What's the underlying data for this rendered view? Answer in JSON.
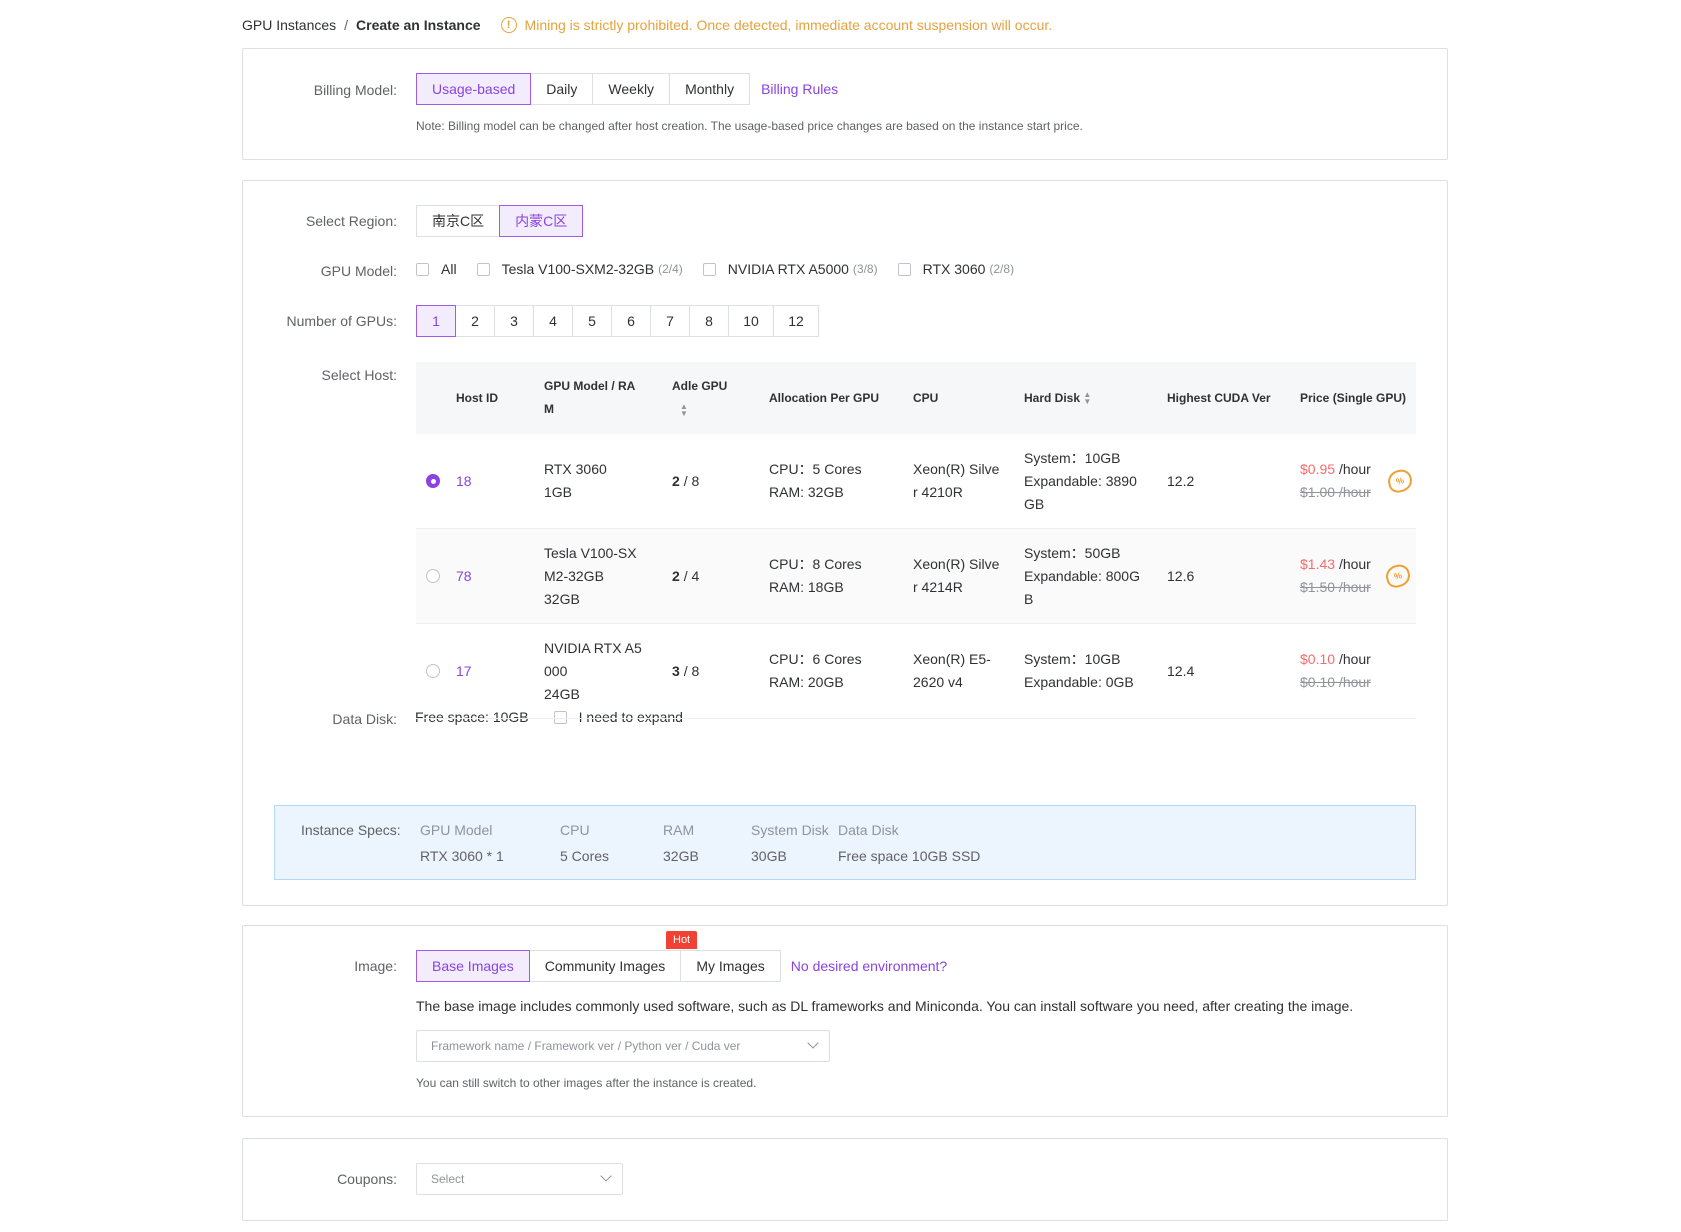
{
  "breadcrumb": {
    "parent": "GPU Instances",
    "separator": "/",
    "current": "Create an Instance"
  },
  "warning": {
    "icon": "exclamation-circle-icon",
    "text": "Mining is strictly prohibited. Once detected, immediate account suspension will occur."
  },
  "billing": {
    "label": "Billing Model:",
    "options": [
      "Usage-based",
      "Daily",
      "Weekly",
      "Monthly"
    ],
    "selected": "Usage-based",
    "rules_link": "Billing Rules",
    "note": "Note: Billing model can be changed after host creation. The usage-based price changes are based on the instance start price."
  },
  "region": {
    "label": "Select Region:",
    "options": [
      "南京C区",
      "内蒙C区"
    ],
    "selected": "内蒙C区"
  },
  "gpu_model": {
    "label": "GPU Model:",
    "options": [
      {
        "name": "All",
        "count": ""
      },
      {
        "name": "Tesla V100-SXM2-32GB",
        "count": "(2/4)"
      },
      {
        "name": "NVIDIA RTX A5000",
        "count": "(3/8)"
      },
      {
        "name": "RTX 3060",
        "count": "(2/8)"
      }
    ]
  },
  "num_gpus": {
    "label": "Number of GPUs:",
    "options": [
      "1",
      "2",
      "3",
      "4",
      "5",
      "6",
      "7",
      "8",
      "10",
      "12"
    ],
    "selected": "1"
  },
  "host": {
    "label": "Select Host:",
    "columns": [
      "Host ID",
      "GPU Model / RA",
      "M",
      "Adle GPU",
      "Allocation Per GPU",
      "CPU",
      "Hard Disk",
      "Highest CUDA Ver",
      "Price (Single GPU)"
    ],
    "rows": [
      {
        "selected": true,
        "id": "18",
        "gpu": [
          "RTX 3060",
          "1GB"
        ],
        "idle": "2",
        "total": "/ 8",
        "alloc": [
          "CPU：5 Cores",
          "RAM: 32GB"
        ],
        "cpu": [
          "Xeon(R) Silve",
          "r 4210R"
        ],
        "disk": [
          "System：10GB",
          "Expandable: 3890",
          "GB"
        ],
        "cuda": "12.2",
        "price": "$0.95",
        "unit": "/hour",
        "old_price": "$1.00 /hour",
        "has_badge": true
      },
      {
        "selected": false,
        "id": "78",
        "gpu": [
          "Tesla V100-SX",
          "M2-32GB",
          "32GB"
        ],
        "idle": "2",
        "total": "/ 4",
        "alloc": [
          "CPU：8 Cores",
          "RAM: 18GB"
        ],
        "cpu": [
          "Xeon(R) Silve",
          "r 4214R"
        ],
        "disk": [
          "System：50GB",
          "Expandable: 800G",
          "B"
        ],
        "cuda": "12.6",
        "price": "$1.43",
        "unit": "/hour",
        "old_price": "$1.50 /hour",
        "has_badge": true
      },
      {
        "selected": false,
        "id": "17",
        "gpu": [
          "NVIDIA RTX A5",
          "000",
          "24GB"
        ],
        "idle": "3",
        "total": "/ 8",
        "alloc": [
          "CPU：6 Cores",
          "RAM: 20GB"
        ],
        "cpu": [
          "Xeon(R) E5-",
          "2620 v4"
        ],
        "disk": [
          "System：10GB",
          "Expandable: 0GB"
        ],
        "cuda": "12.4",
        "price": "$0.10",
        "unit": "/hour",
        "old_price": "$0.10 /hour",
        "has_badge": false
      }
    ]
  },
  "data_disk": {
    "label": "Data Disk:",
    "free": "Free space: 10GB",
    "expand": "I need to expand"
  },
  "specs": {
    "label": "Instance Specs:",
    "headers": [
      "GPU Model",
      "CPU",
      "RAM",
      "System Disk",
      "Data Disk"
    ],
    "values": [
      "RTX 3060 * 1",
      "5 Cores",
      "32GB",
      "30GB",
      "Free space 10GB SSD"
    ]
  },
  "image": {
    "label": "Image:",
    "tabs": [
      "Base Images",
      "Community Images",
      "My Images"
    ],
    "selected": "Base Images",
    "hot_badge": "Hot",
    "help_link": "No desired environment?",
    "description": "The base image includes commonly used software, such as DL frameworks and Miniconda. You can install software you need, after creating the image.",
    "placeholder": "Framework name / Framework ver / Python ver / Cuda ver",
    "hint": "You can still switch to other images after the instance is created."
  },
  "coupons": {
    "label": "Coupons:",
    "placeholder": "Select"
  },
  "colors": {
    "accent": "#8a43e0",
    "warning": "#e6a23c",
    "price": "#f56c6c",
    "hot": "#f04134"
  }
}
